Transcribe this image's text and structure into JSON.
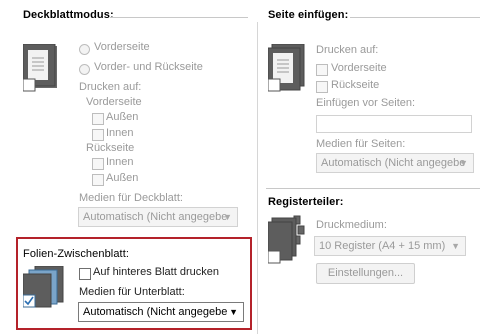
{
  "deckblatt": {
    "title": "Deckblattmodus:",
    "radio_front": "Vorderseite",
    "radio_front_back": "Vorder- und Rückseite",
    "print_on": "Drucken auf:",
    "front": "Vorderseite",
    "front_outer": "Außen",
    "front_inner": "Innen",
    "back": "Rückseite",
    "back_inner": "Innen",
    "back_outer": "Außen",
    "media_label": "Medien für Deckblatt:",
    "media_value": "Automatisch (Nicht angegebe"
  },
  "seite": {
    "title": "Seite einfügen:",
    "print_on": "Drucken auf:",
    "front": "Vorderseite",
    "back": "Rückseite",
    "insert_before": "Einfügen vor Seiten:",
    "insert_value": "",
    "media_label": "Medien für Seiten:",
    "media_value": "Automatisch (Nicht angegebe"
  },
  "register": {
    "title": "Registerteiler:",
    "medium_label": "Druckmedium:",
    "medium_value": "10 Register (A4 + 15 mm)",
    "settings_button": "Einstellungen..."
  },
  "folien": {
    "title": "Folien-Zwischenblatt:",
    "print_back": "Auf hinteres Blatt drucken",
    "media_label": "Medien für Unterblatt:",
    "media_value": "Automatisch (Nicht angegebe"
  },
  "colors": {
    "highlight_border": "#b4222a",
    "disabled_text": "#9a9a9a"
  }
}
